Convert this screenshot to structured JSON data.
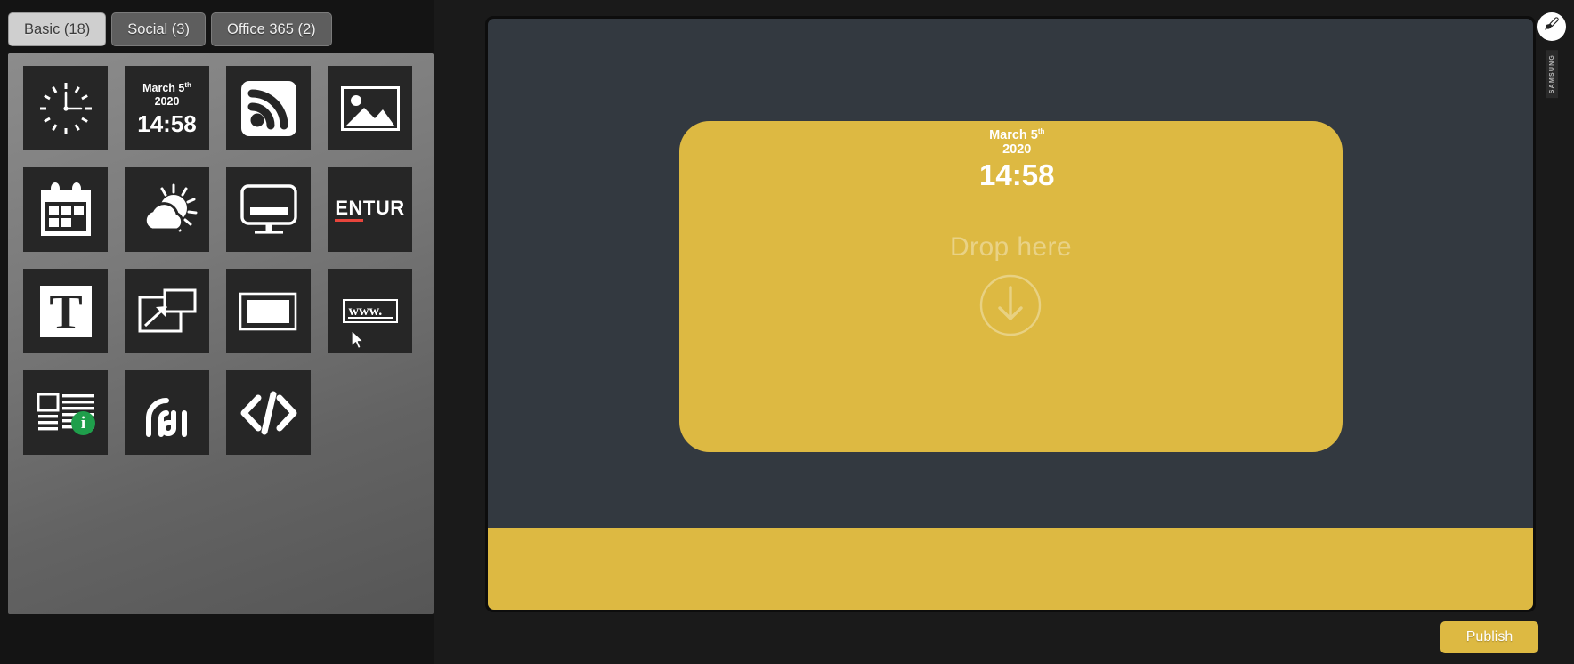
{
  "tabs": [
    {
      "label": "Basic (18)",
      "name": "tab-basic",
      "active": true
    },
    {
      "label": "Social (3)",
      "name": "tab-social",
      "active": false
    },
    {
      "label": "Office 365 (2)",
      "name": "tab-office365",
      "active": false
    }
  ],
  "widgets": [
    {
      "icon": "analog-clock-icon",
      "label": "Clock"
    },
    {
      "icon": "date-time-icon",
      "label": "Date and Time",
      "date_line1": "March 5",
      "date_sup": "th",
      "date_line2": "2020",
      "time": "14:58"
    },
    {
      "icon": "rss-feed-icon",
      "label": "RSS Feed"
    },
    {
      "icon": "image-icon",
      "label": "Image"
    },
    {
      "icon": "calendar-icon",
      "label": "Calendar"
    },
    {
      "icon": "weather-icon",
      "label": "Weather"
    },
    {
      "icon": "monitor-icon",
      "label": "Display"
    },
    {
      "icon": "entur-logo-icon",
      "label": "Entur",
      "text_primary": "EN",
      "text_secondary": "TUR"
    },
    {
      "icon": "text-t-icon",
      "label": "Text"
    },
    {
      "icon": "popup-window-icon",
      "label": "Popup"
    },
    {
      "icon": "video-frame-icon",
      "label": "Video"
    },
    {
      "icon": "web-url-icon",
      "label": "Web Page",
      "text": "www."
    },
    {
      "icon": "news-info-icon",
      "label": "News",
      "badge": "i"
    },
    {
      "icon": "wifi-signal-icon",
      "label": "Signal"
    },
    {
      "icon": "code-embed-icon",
      "label": "Embed Code"
    }
  ],
  "canvas": {
    "dropzone": {
      "text": "Drop here",
      "icon": "download-circle-icon",
      "color": "#ddb942"
    },
    "drag_ghost": {
      "date_line1": "March 5",
      "date_sup": "th",
      "date_line2": "2020",
      "time": "14:58"
    },
    "bottom_band_color": "#ddb942",
    "background_color": "#333940"
  },
  "right_rail": {
    "brush_button": {
      "icon": "paintbrush-icon",
      "name": "brush-button"
    },
    "brand_label": "SAMSUNG"
  },
  "footer": {
    "publish_label": "Publish",
    "accent_color": "#ddb942"
  }
}
